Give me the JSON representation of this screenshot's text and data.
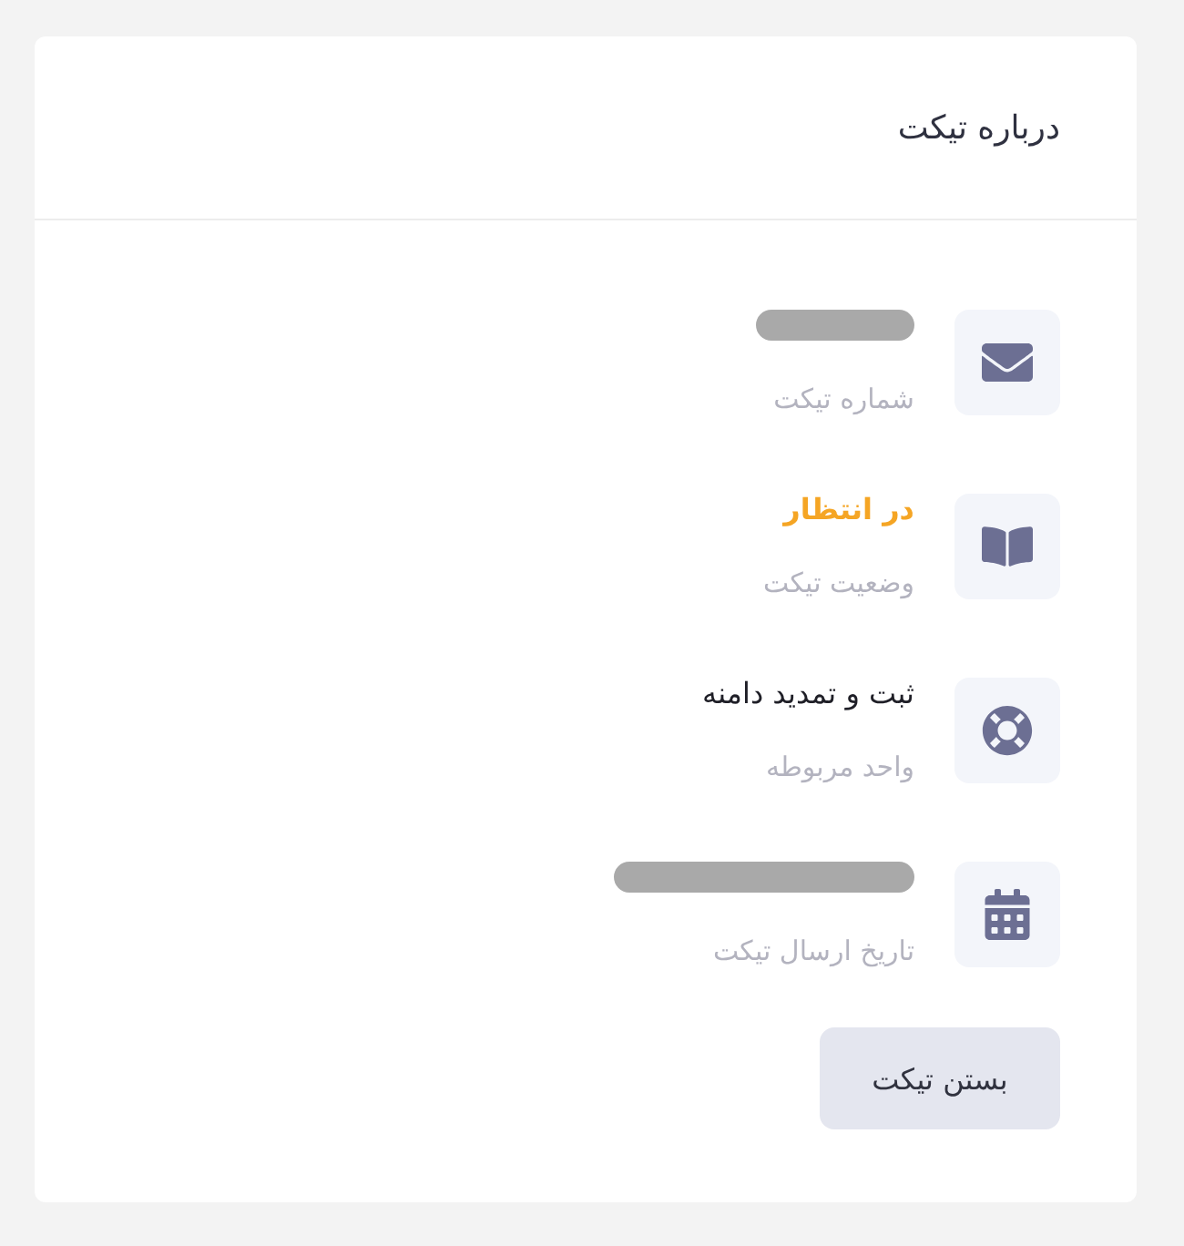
{
  "panel": {
    "title": "درباره تیکت"
  },
  "details": [
    {
      "kind": "redacted",
      "label": "شماره تیکت"
    },
    {
      "kind": "status",
      "value": "در انتظار",
      "label": "وضعیت تیکت"
    },
    {
      "kind": "text",
      "value": "ثبت و تمدید دامنه",
      "label": "واحد مربوطه"
    },
    {
      "kind": "redacted",
      "label": "تاریخ ارسال تیکت"
    }
  ],
  "close_button": {
    "label": "بستن تیکت"
  }
}
